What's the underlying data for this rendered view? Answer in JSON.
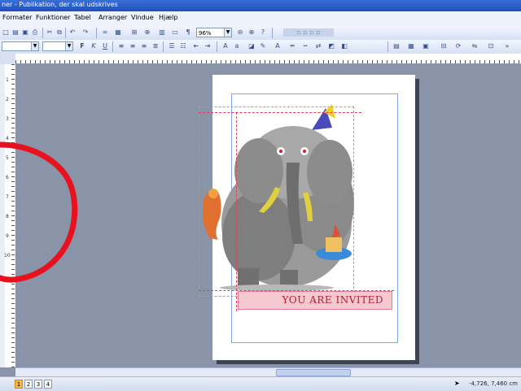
{
  "titlebar": {
    "title": "ner - Publikation, der skal udskrives"
  },
  "menubar": {
    "items": [
      "Formater",
      "Funktioner",
      "Tabel",
      "Arranger",
      "Vindue",
      "Hjælp"
    ]
  },
  "toolbar": {
    "zoom_value": "96%",
    "icons": [
      "new-icon",
      "open-icon",
      "save-icon",
      "print-icon",
      "undo-icon",
      "redo-icon",
      "zoom-in-icon",
      "zoom-out-icon",
      "help-icon"
    ]
  },
  "format_toolbar": {
    "style_value": "",
    "font_value": "",
    "bold": "F",
    "italic": "K",
    "underline": "U"
  },
  "rulers": {
    "vertical_labels": [
      "1",
      "2",
      "3",
      "4",
      "5",
      "6",
      "7",
      "8",
      "9",
      "10"
    ]
  },
  "document": {
    "invitation_text": "YOU ARE INVITED"
  },
  "statusbar": {
    "pages": [
      "1",
      "2",
      "3",
      "4"
    ],
    "active_page": "1",
    "coordinates": "-4,726, 7,460 cm"
  },
  "colors": {
    "accent": "#1f4fb8",
    "annotation": "#e8121e",
    "invite_text": "#b0202c",
    "invite_bg": "#f6c8d2"
  }
}
